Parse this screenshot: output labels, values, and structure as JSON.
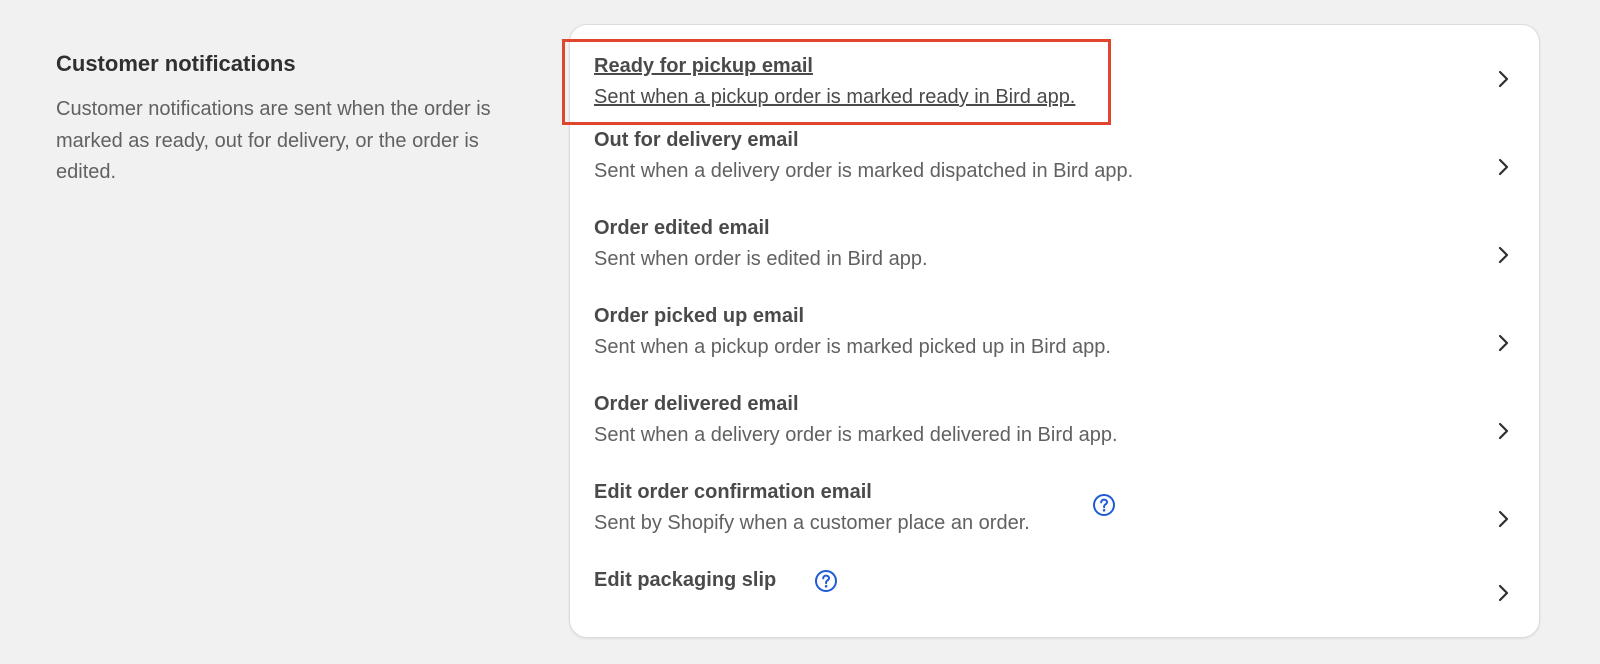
{
  "section": {
    "title": "Customer notifications",
    "description": "Customer notifications are sent when the order is marked as ready, out for delivery, or the order is edited."
  },
  "notifications": [
    {
      "title": "Ready for pickup email",
      "description": "Sent when a pickup order is marked ready in Bird app."
    },
    {
      "title": "Out for delivery email",
      "description": "Sent when a delivery order is marked dispatched in Bird app."
    },
    {
      "title": "Order edited email",
      "description": "Sent when order is edited in Bird app."
    },
    {
      "title": "Order picked up email",
      "description": "Sent when a pickup order is marked picked up in Bird app."
    },
    {
      "title": "Order delivered email",
      "description": "Sent when a delivery order is marked delivered in Bird app."
    },
    {
      "title": "Edit order confirmation email",
      "description": "Sent by Shopify when a customer place an order."
    },
    {
      "title": "Edit packaging slip"
    }
  ],
  "icons": {
    "chevron": "chevron-right-icon",
    "help": "question-circle-icon"
  },
  "colors": {
    "highlight_border": "#e0452e",
    "help_icon": "#1f5bd6"
  }
}
